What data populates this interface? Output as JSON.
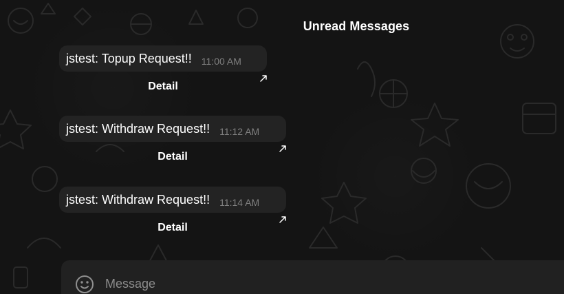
{
  "chat": {
    "unread_banner": "Unread Messages",
    "messages": [
      {
        "text": "jstest: Topup Request!!",
        "time": "11:00 AM",
        "button_label": "Detail"
      },
      {
        "text": "jstest: Withdraw Request!!",
        "time": "11:12 AM",
        "button_label": "Detail"
      },
      {
        "text": "jstest: Withdraw Request!!",
        "time": "11:14 AM",
        "button_label": "Detail"
      }
    ]
  },
  "composer": {
    "placeholder": "Message",
    "emoji_icon": "smiley-face-icon"
  },
  "colors": {
    "background": "#141414",
    "bubble": "#232323",
    "input_bar": "#212121",
    "time_text": "#808080",
    "placeholder_text": "#8d8d8d"
  }
}
